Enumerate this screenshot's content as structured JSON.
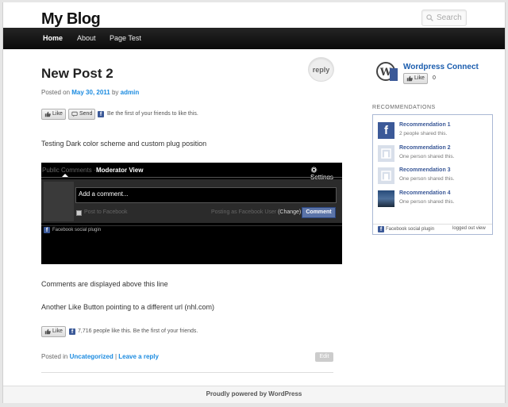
{
  "site": {
    "title": "My Blog",
    "search_placeholder": "Search"
  },
  "nav": {
    "items": [
      "Home",
      "About",
      "Page Test"
    ]
  },
  "post": {
    "title": "New Post 2",
    "reply_label": "reply",
    "posted_on": "Posted on",
    "date": "May 30, 2011",
    "by": "by",
    "author": "admin",
    "like_label": "Like",
    "send_label": "Send",
    "like_text": "Be the first of your friends to like this.",
    "intro": "Testing Dark color scheme and custom plug position",
    "after_comments": "Comments are displayed above this line",
    "another_like": "Another Like Button pointing to a different url (nhl.com)",
    "like2_label": "Like",
    "like2_text": "7,716 people like this. Be the first of your friends.",
    "posted_in": "Posted in",
    "category": "Uncategorized",
    "sep": "|",
    "leave_reply": "Leave a reply",
    "edit_label": "Edit"
  },
  "comments_box": {
    "tab_public": "Public Comments ·",
    "tab_moderator": "Moderator View",
    "settings": "Settings",
    "placeholder": "Add a comment...",
    "post_to_fb": "Post to Facebook",
    "posting_as": "Posting as Facebook User",
    "change": "(Change)",
    "comment_btn": "Comment",
    "plugin": "Facebook social plugin"
  },
  "sidebar": {
    "wp_connect_title": "Wordpress Connect",
    "wp_like": "Like",
    "wp_count": "0",
    "rec_title": "RECOMMENDATIONS",
    "recs": [
      {
        "name": "Recommendation 1",
        "sub": "2 people shared this."
      },
      {
        "name": "Recommendation 2",
        "sub": "One person shared this."
      },
      {
        "name": "Recommendation 3",
        "sub": "One person shared this."
      },
      {
        "name": "Recommendation 4",
        "sub": "One person shared this."
      }
    ],
    "rec_plugin": "Facebook social plugin",
    "rec_logged_out": "logged out view"
  },
  "footer": {
    "text": "Proudly powered by WordPress"
  }
}
